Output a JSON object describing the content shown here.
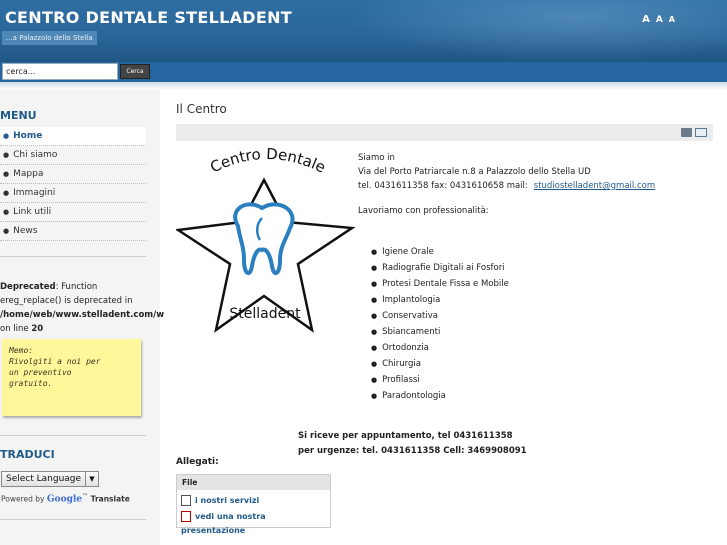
{
  "header": {
    "title": "CENTRO DENTALE STELLADENT",
    "tagline": "...a Palazzolo dello Stella",
    "font_sizer": [
      "A",
      "A",
      "A"
    ]
  },
  "search": {
    "value": "cerca...",
    "button_label": "Cerca"
  },
  "sidebar": {
    "menu_title": "MENU",
    "items": [
      {
        "label": "Home",
        "active": true
      },
      {
        "label": "Chi siamo"
      },
      {
        "label": "Mappa"
      },
      {
        "label": "Immagini"
      },
      {
        "label": "Link utili"
      },
      {
        "label": "News"
      }
    ],
    "warning": {
      "label": "Deprecated",
      "text1": ": Function ereg_replace() is deprecated in ",
      "path": "/home/web/www.stelladent.com/w",
      "text2": " on line ",
      "line": "20"
    },
    "memo": {
      "line1": "Memo:",
      "line2": "Rivolgiti a noi per",
      "line3": "un preventivo",
      "line4": "gratuito."
    },
    "translate": {
      "title": "TRADUCI",
      "select_label": "Select Language",
      "powered_by": "Powered by",
      "google": "Google",
      "tm": "™",
      "translate": "Translate"
    }
  },
  "main": {
    "page_title": "Il Centro",
    "logo": {
      "top_text": "Centro Dentale",
      "bottom_text": "Stelladent"
    },
    "intro": {
      "line1": "Siamo in",
      "line2": "Via del Porto Patriarcale n.8 a Palazzolo dello Stella UD",
      "line3": "tel. 0431611358 fax: 0431610658 mail:",
      "email": "studiostelladent@gmail.com"
    },
    "pro_title": "Lavoriamo con professionalità:",
    "services": [
      "Igiene Orale",
      "Radiografie Digitali ai Fosfori",
      "Protesi Dentale Fissa e Mobile",
      "Implantologia",
      "Conservativa",
      "Sbiancamenti",
      "Ortodonzia",
      "Chirurgia",
      "Profilassi",
      "Paradontologia"
    ],
    "appointment": {
      "line1": "Si riceve per appuntamento, tel 0431611358",
      "line2": "per urgenze: tel. 0431611358 Cell: 3469908091"
    },
    "attachments": {
      "title": "Allegati:",
      "header": "File",
      "files": [
        {
          "label": "i nostri servizi",
          "icon": "document-icon"
        },
        {
          "label": "vedi una nostra presentazione",
          "icon": "pdf-icon"
        }
      ]
    }
  },
  "colors": {
    "header_blue": "#2a6597",
    "accent_blue": "#1f5a8a",
    "memo_yellow": "#fff79a"
  }
}
